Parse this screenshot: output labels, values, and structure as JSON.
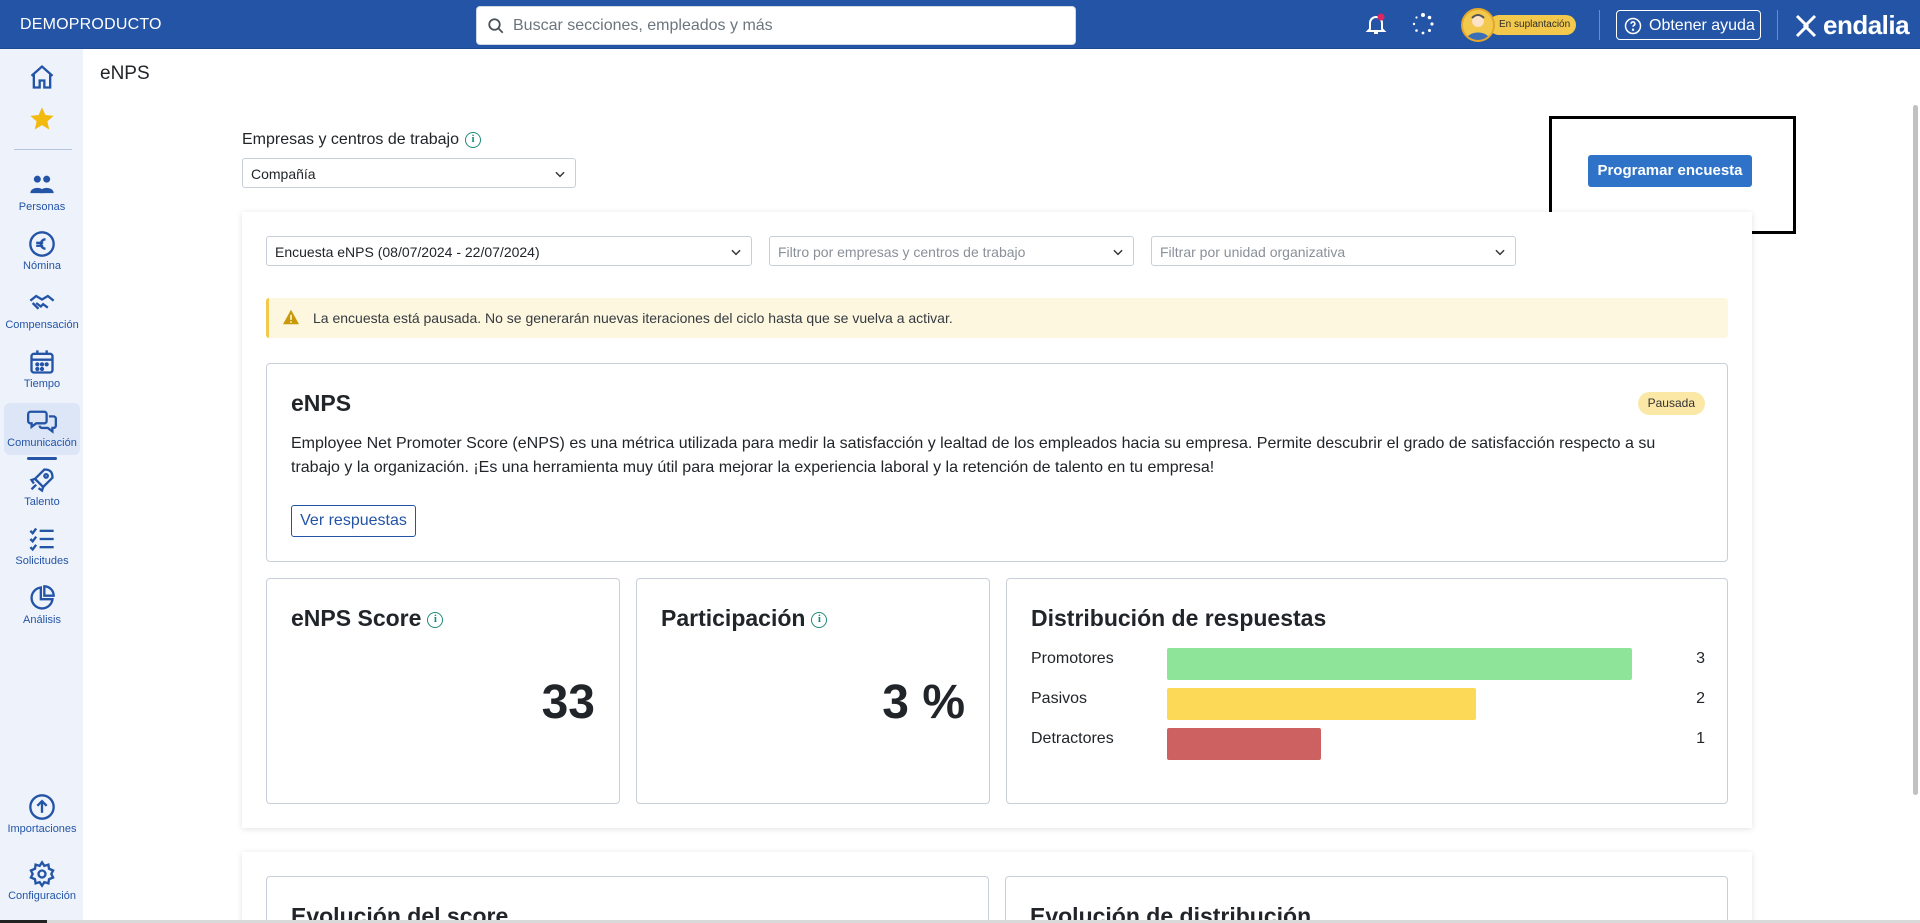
{
  "topbar": {
    "brand": "DEMOPRODUCTO",
    "search_placeholder": "Buscar secciones, empleados y más",
    "impersonation_badge": "En suplantación",
    "help_label": "Obtener ayuda",
    "logo_text": "endalia",
    "icons": [
      "bell-icon",
      "spinner-icon",
      "help-circle-icon",
      "endalia-logo-icon"
    ],
    "notification_color": "#e0245e"
  },
  "sidebar": {
    "items": [
      {
        "label": "",
        "icon": "home-icon"
      },
      {
        "label": "",
        "icon": "star-icon"
      },
      {
        "label": "Personas",
        "icon": "people-icon"
      },
      {
        "label": "Nómina",
        "icon": "euro-icon"
      },
      {
        "label": "Compensación",
        "icon": "handshake-icon"
      },
      {
        "label": "Tiempo",
        "icon": "calendar-icon"
      },
      {
        "label": "Comunicación",
        "icon": "chat-icon",
        "active": true
      },
      {
        "label": "Talento",
        "icon": "rocket-icon"
      },
      {
        "label": "Solicitudes",
        "icon": "checklist-icon"
      },
      {
        "label": "Análisis",
        "icon": "pie-chart-icon"
      },
      {
        "label": "Importaciones",
        "icon": "upload-icon"
      },
      {
        "label": "Configuración",
        "icon": "gear-icon"
      }
    ]
  },
  "page": {
    "title": "eNPS",
    "company_filter_label": "Empresas y centros de trabajo",
    "company_select_value": "Compañía",
    "schedule_button": "Programar encuesta"
  },
  "filters": {
    "survey_value": "Encuesta eNPS (08/07/2024 - 22/07/2024)",
    "company_placeholder": "Filtro por empresas y centros de trabajo",
    "unit_placeholder": "Filtrar por unidad organizativa"
  },
  "alert": {
    "text": "La encuesta está pausada. No se generarán nuevas iteraciones del ciclo hasta que se vuelva a activar."
  },
  "enps_card": {
    "title": "eNPS",
    "status": "Pausada",
    "description": "Employee Net Promoter Score (eNPS) es una métrica utilizada para medir la satisfacción y lealtad de los empleados hacia su empresa. Permite descubrir el grado de satisfacción respecto a su trabajo y la organización. ¡Es una herramienta muy útil para mejorar la experiencia laboral y la retención de talento en tu empresa!",
    "view_button": "Ver respuestas"
  },
  "score_card": {
    "title": "eNPS Score",
    "value": "33"
  },
  "participation_card": {
    "title": "Participación",
    "value": "3 %"
  },
  "distribution_card": {
    "title": "Distribución de respuestas",
    "rows": [
      {
        "label": "Promotores",
        "count": "3",
        "color": "#8ee59a"
      },
      {
        "label": "Pasivos",
        "count": "2",
        "color": "#fcd957"
      },
      {
        "label": "Detractores",
        "count": "1",
        "color": "#cd6162"
      }
    ]
  },
  "lower_cards": {
    "score_evolution_title": "Evolución del score",
    "distribution_evolution_title": "Evolución de distribución"
  },
  "colors": {
    "brand_blue": "#2354a6",
    "primary_button": "#2e73c8",
    "alert_bg": "#fdf7df",
    "badge_yellow": "#fbe7a6"
  }
}
